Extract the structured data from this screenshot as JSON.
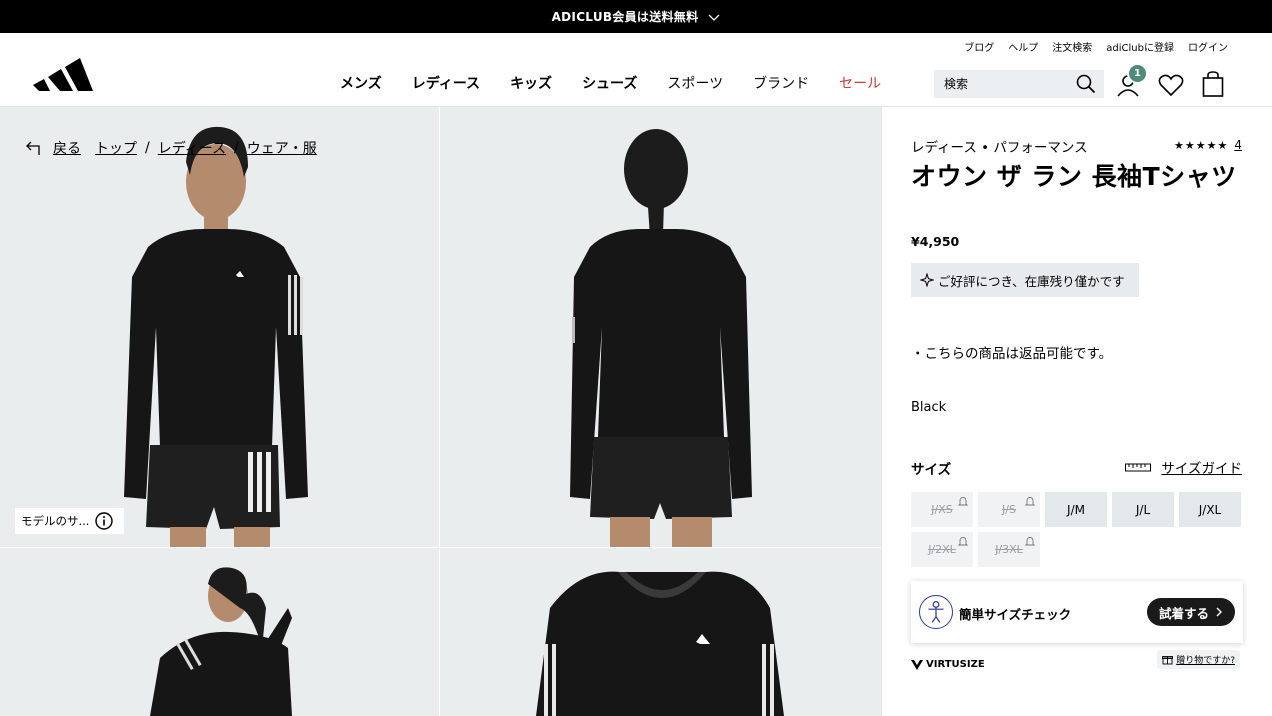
{
  "promo": {
    "text": "ADICLUB会員は送料無料"
  },
  "utility_links": [
    "ブログ",
    "ヘルプ",
    "注文検索",
    "adiClubに登録",
    "ログイン"
  ],
  "nav": {
    "items": [
      {
        "label": "メンズ",
        "style": "bold"
      },
      {
        "label": "レディース",
        "style": "bold"
      },
      {
        "label": "キッズ",
        "style": "bold"
      },
      {
        "label": "シューズ",
        "style": "bold"
      },
      {
        "label": "スポーツ",
        "style": "normal"
      },
      {
        "label": "ブランド",
        "style": "normal"
      },
      {
        "label": "セール",
        "style": "sale"
      }
    ]
  },
  "search": {
    "placeholder": "検索"
  },
  "account": {
    "badge_count": "1"
  },
  "breadcrumb": {
    "back": "戻る",
    "items": [
      "トップ",
      "レディース",
      "ウェア・服"
    ],
    "separator": "/"
  },
  "gallery": {
    "model_size_button": "モデルのサ..."
  },
  "product": {
    "category": "レディース • パフォーマンス",
    "stars": "★★★★★",
    "review_count": "4",
    "title": "オウン ザ ラン 長袖Tシャツ",
    "price": "¥4,950",
    "stock_notice": "ご好評につき、在庫残り僅かです",
    "returns": "・こちらの商品は返品可能です。",
    "color": "Black"
  },
  "sizing": {
    "label": "サイズ",
    "guide": "サイズガイド",
    "sizes": [
      {
        "label": "J/XS",
        "available": false
      },
      {
        "label": "J/S",
        "available": false
      },
      {
        "label": "J/M",
        "available": true
      },
      {
        "label": "J/L",
        "available": true
      },
      {
        "label": "J/XL",
        "available": true
      },
      {
        "label": "J/2XL",
        "available": false
      },
      {
        "label": "J/3XL",
        "available": false
      }
    ]
  },
  "virtusize": {
    "check_label": "簡単サイズチェック",
    "try_button": "試着する",
    "brand": "VIRTUSIZE",
    "gift": "贈り物ですか?"
  },
  "colors": {
    "sale": "#d03a3a",
    "badge": "#4f8a7b",
    "tile_bg": "#eaedee"
  }
}
